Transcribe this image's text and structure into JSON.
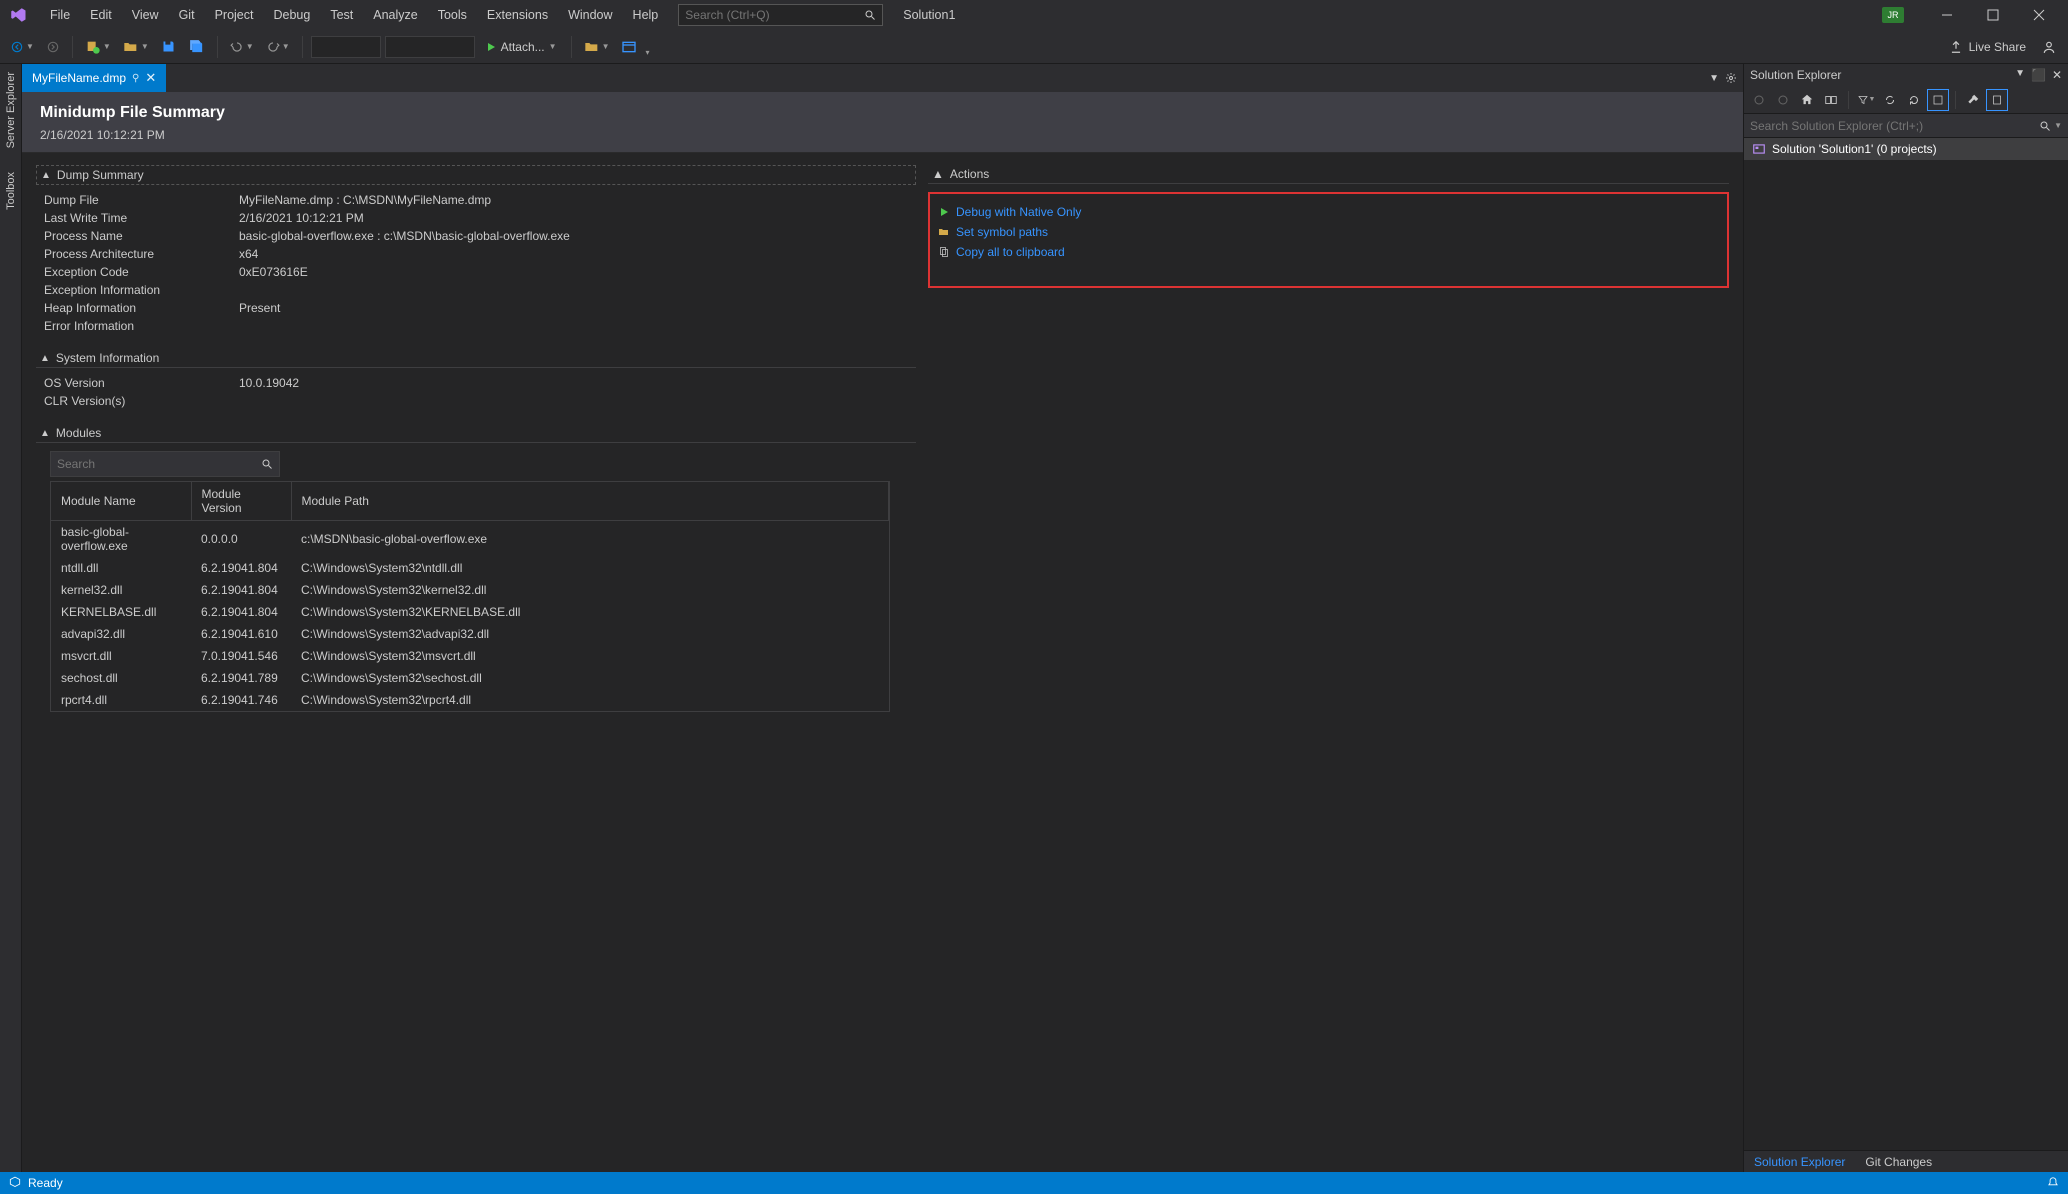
{
  "menu": [
    "File",
    "Edit",
    "View",
    "Git",
    "Project",
    "Debug",
    "Test",
    "Analyze",
    "Tools",
    "Extensions",
    "Window",
    "Help"
  ],
  "search_placeholder": "Search (Ctrl+Q)",
  "solution_name": "Solution1",
  "user_badge": "JR",
  "toolbar": {
    "attach": "Attach..."
  },
  "live_share": "Live Share",
  "left_rail": [
    "Server Explorer",
    "Toolbox"
  ],
  "tab": {
    "name": "MyFileName.dmp"
  },
  "doc": {
    "title": "Minidump File Summary",
    "timestamp": "2/16/2021 10:12:21 PM"
  },
  "dump_section_title": "Dump Summary",
  "sys_section_title": "System Information",
  "modules_section_title": "Modules",
  "actions_title": "Actions",
  "dump": [
    {
      "k": "Dump File",
      "v": "MyFileName.dmp : C:\\MSDN\\MyFileName.dmp"
    },
    {
      "k": "Last Write Time",
      "v": "2/16/2021 10:12:21 PM"
    },
    {
      "k": "Process Name",
      "v": "basic-global-overflow.exe : c:\\MSDN\\basic-global-overflow.exe"
    },
    {
      "k": "Process Architecture",
      "v": "x64"
    },
    {
      "k": "Exception Code",
      "v": "0xE073616E"
    },
    {
      "k": "Exception Information",
      "v": ""
    },
    {
      "k": "Heap Information",
      "v": "Present"
    },
    {
      "k": "Error Information",
      "v": ""
    }
  ],
  "sys": [
    {
      "k": "OS Version",
      "v": "10.0.19042"
    },
    {
      "k": "CLR Version(s)",
      "v": ""
    }
  ],
  "mod_search_placeholder": "Search",
  "mod_headers": [
    "Module Name",
    "Module Version",
    "Module Path"
  ],
  "modules": [
    {
      "n": "basic-global-overflow.exe",
      "v": "0.0.0.0",
      "p": "c:\\MSDN\\basic-global-overflow.exe"
    },
    {
      "n": "ntdll.dll",
      "v": "6.2.19041.804",
      "p": "C:\\Windows\\System32\\ntdll.dll"
    },
    {
      "n": "kernel32.dll",
      "v": "6.2.19041.804",
      "p": "C:\\Windows\\System32\\kernel32.dll"
    },
    {
      "n": "KERNELBASE.dll",
      "v": "6.2.19041.804",
      "p": "C:\\Windows\\System32\\KERNELBASE.dll"
    },
    {
      "n": "advapi32.dll",
      "v": "6.2.19041.610",
      "p": "C:\\Windows\\System32\\advapi32.dll"
    },
    {
      "n": "msvcrt.dll",
      "v": "7.0.19041.546",
      "p": "C:\\Windows\\System32\\msvcrt.dll"
    },
    {
      "n": "sechost.dll",
      "v": "6.2.19041.789",
      "p": "C:\\Windows\\System32\\sechost.dll"
    },
    {
      "n": "rpcrt4.dll",
      "v": "6.2.19041.746",
      "p": "C:\\Windows\\System32\\rpcrt4.dll"
    }
  ],
  "actions": [
    {
      "icon": "play",
      "label": "Debug with Native Only"
    },
    {
      "icon": "folder",
      "label": "Set symbol paths"
    },
    {
      "icon": "copy",
      "label": "Copy all to clipboard"
    }
  ],
  "se": {
    "title": "Solution Explorer",
    "search_placeholder": "Search Solution Explorer (Ctrl+;)",
    "item": "Solution 'Solution1' (0 projects)",
    "tabs": [
      "Solution Explorer",
      "Git Changes"
    ]
  },
  "status": {
    "text": "Ready"
  }
}
